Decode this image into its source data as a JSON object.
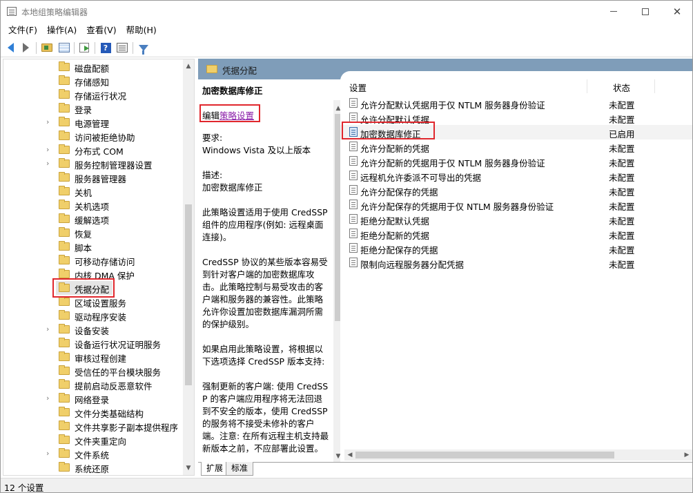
{
  "window": {
    "title": "本地组策略编辑器",
    "minimize": "—",
    "maximize": "☐",
    "close": "✕"
  },
  "menu": [
    "文件(F)",
    "操作(A)",
    "查看(V)",
    "帮助(H)"
  ],
  "toolbar": {
    "icons": [
      "back-arrow-icon",
      "forward-arrow-icon",
      "up-folder-icon",
      "show-hide-tree-icon",
      "export-list-icon",
      "help-icon",
      "properties-icon",
      "filter-icon"
    ]
  },
  "tree": {
    "items": [
      {
        "label": "磁盘配额",
        "expandable": false
      },
      {
        "label": "存储感知",
        "expandable": false
      },
      {
        "label": "存储运行状况",
        "expandable": false
      },
      {
        "label": "登录",
        "expandable": false
      },
      {
        "label": "电源管理",
        "expandable": true
      },
      {
        "label": "访问被拒绝协助",
        "expandable": false
      },
      {
        "label": "分布式 COM",
        "expandable": true
      },
      {
        "label": "服务控制管理器设置",
        "expandable": true
      },
      {
        "label": "服务器管理器",
        "expandable": false
      },
      {
        "label": "关机",
        "expandable": false
      },
      {
        "label": "关机选项",
        "expandable": false
      },
      {
        "label": "缓解选项",
        "expandable": false
      },
      {
        "label": "恢复",
        "expandable": false
      },
      {
        "label": "脚本",
        "expandable": false
      },
      {
        "label": "可移动存储访问",
        "expandable": false
      },
      {
        "label": "内核 DMA 保护",
        "expandable": false
      },
      {
        "label": "凭据分配",
        "expandable": false,
        "selected": true
      },
      {
        "label": "区域设置服务",
        "expandable": false
      },
      {
        "label": "驱动程序安装",
        "expandable": false
      },
      {
        "label": "设备安装",
        "expandable": true
      },
      {
        "label": "设备运行状况证明服务",
        "expandable": false
      },
      {
        "label": "审核过程创建",
        "expandable": false
      },
      {
        "label": "受信任的平台模块服务",
        "expandable": false
      },
      {
        "label": "提前启动反恶意软件",
        "expandable": false
      },
      {
        "label": "网络登录",
        "expandable": true
      },
      {
        "label": "文件分类基础结构",
        "expandable": false
      },
      {
        "label": "文件共享影子副本提供程序",
        "expandable": false
      },
      {
        "label": "文件夹重定向",
        "expandable": false
      },
      {
        "label": "文件系统",
        "expandable": true
      },
      {
        "label": "系统还原",
        "expandable": false
      }
    ]
  },
  "header": {
    "title": "凭据分配"
  },
  "description": {
    "title": "加密数据库修正",
    "edit_prefix": "编辑",
    "edit_link": "策略设置",
    "body": "要求:\nWindows Vista 及以上版本\n\n描述:\n加密数据库修正\n\n此策略设置适用于使用 CredSSP 组件的应用程序(例如: 远程桌面连接)。\n\nCredSSP 协议的某些版本容易受到针对客户端的加密数据库攻击。此策略控制与易受攻击的客户端和服务器的兼容性。此策略允许你设置加密数据库漏洞所需的保护级别。\n\n如果启用此策略设置，将根据以下选项选择 CredSSP 版本支持:\n\n强制更新的客户端: 使用 CredSSP 的客户端应用程序将无法回退到不安全的版本，使用 CredSSP 的服务将不接受未修补的客户端。注意: 在所有远程主机支持最新版本之前，不应部署此设置。\n\n减轻: 使用 CredSSP 的客户端应用程序将无法回退到不安全的版本，"
  },
  "list": {
    "columns": {
      "setting": "设置",
      "state": "状态"
    },
    "rows": [
      {
        "name": "允许分配默认凭据用于仅 NTLM 服务器身份验证",
        "state": "未配置"
      },
      {
        "name": "允许分配默认凭据",
        "state": "未配置"
      },
      {
        "name": "加密数据库修正",
        "state": "已启用",
        "highlight": true
      },
      {
        "name": "允许分配新的凭据",
        "state": "未配置"
      },
      {
        "name": "允许分配新的凭据用于仅 NTLM 服务器身份验证",
        "state": "未配置"
      },
      {
        "name": "远程机允许委派不可导出的凭据",
        "state": "未配置"
      },
      {
        "name": "允许分配保存的凭据",
        "state": "未配置"
      },
      {
        "name": "允许分配保存的凭据用于仅 NTLM 服务器身份验证",
        "state": "未配置"
      },
      {
        "name": "拒绝分配默认凭据",
        "state": "未配置"
      },
      {
        "name": "拒绝分配新的凭据",
        "state": "未配置"
      },
      {
        "name": "拒绝分配保存的凭据",
        "state": "未配置"
      },
      {
        "name": "限制向远程服务器分配凭据",
        "state": "未配置"
      }
    ]
  },
  "tabs": [
    "扩展",
    "标准"
  ],
  "status": {
    "text": "12 个设置"
  },
  "colors": {
    "header_bg": "#7f9db9",
    "highlight_box": "#e0262c",
    "link": "#8a1ca8"
  }
}
